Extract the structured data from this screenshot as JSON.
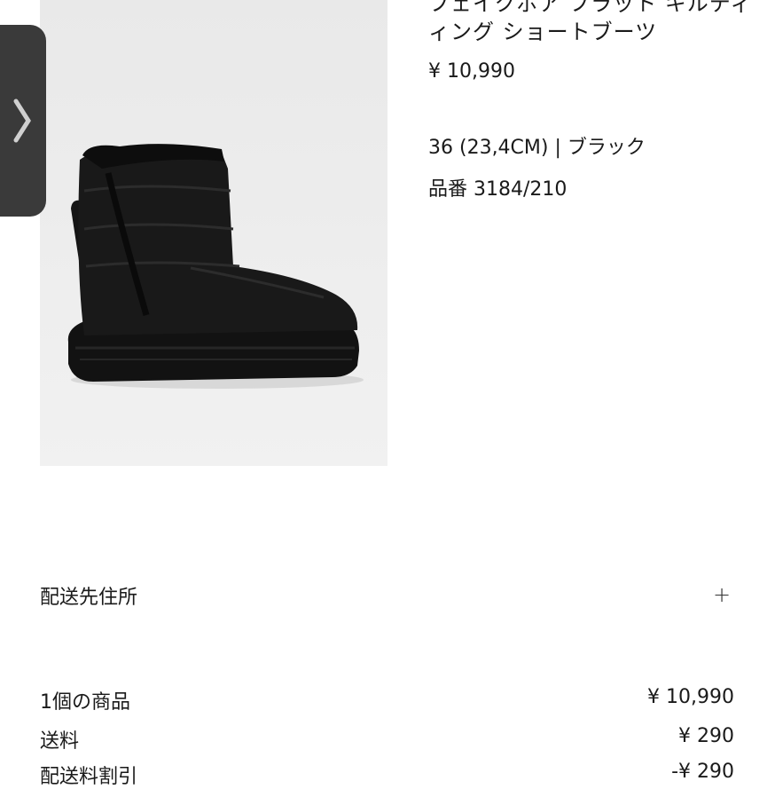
{
  "product": {
    "title_line1": "フェイクボア フラット キルティ",
    "title_line2": "ィング ショートブーツ",
    "price": "¥ 10,990",
    "variant": "36 (23,4CM) | ブラック",
    "reference": "品番 3184/210",
    "image_icon": "black-quilted-short-boot"
  },
  "carousel": {
    "next_icon": "chevron-right-icon"
  },
  "shipping": {
    "address_label": "配送先住所",
    "expand_icon": "plus-icon",
    "expand_symbol": "+"
  },
  "summary": {
    "rows": [
      {
        "label": "1個の商品",
        "value": "¥ 10,990"
      },
      {
        "label": "送料",
        "value": "¥ 290"
      },
      {
        "label": "配送料割引",
        "value": "-¥ 290"
      }
    ]
  }
}
